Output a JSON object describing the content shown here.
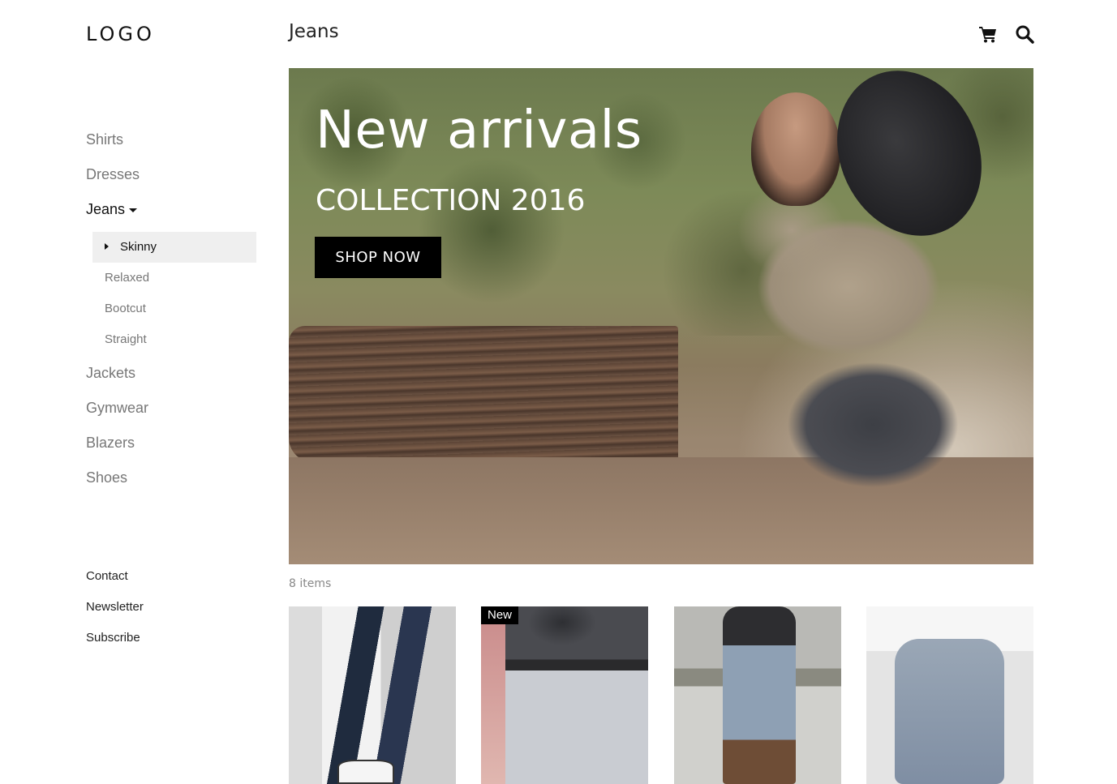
{
  "logo": "LOGO",
  "header": {
    "title": "Jeans",
    "icons": [
      "cart-icon",
      "search-icon"
    ]
  },
  "sidebar": {
    "categories": [
      {
        "label": "Shirts",
        "active": false
      },
      {
        "label": "Dresses",
        "active": false
      },
      {
        "label": "Jeans",
        "active": true,
        "expanded": true
      },
      {
        "label": "Jackets",
        "active": false
      },
      {
        "label": "Gymwear",
        "active": false
      },
      {
        "label": "Blazers",
        "active": false
      },
      {
        "label": "Shoes",
        "active": false
      }
    ],
    "subcategories": [
      {
        "label": "Skinny",
        "active": true
      },
      {
        "label": "Relaxed",
        "active": false
      },
      {
        "label": "Bootcut",
        "active": false
      },
      {
        "label": "Straight",
        "active": false
      }
    ],
    "footer_links": [
      "Contact",
      "Newsletter",
      "Subscribe"
    ]
  },
  "hero": {
    "title": "New arrivals",
    "subtitle": "COLLECTION 2016",
    "button_label": "SHOP NOW"
  },
  "items_count": "8 items",
  "products": [
    {
      "badge": ""
    },
    {
      "badge": "New"
    },
    {
      "badge": ""
    },
    {
      "badge": ""
    }
  ],
  "colors": {
    "accent": "#000000",
    "muted_text": "#777777",
    "active_bg": "#efefef"
  }
}
